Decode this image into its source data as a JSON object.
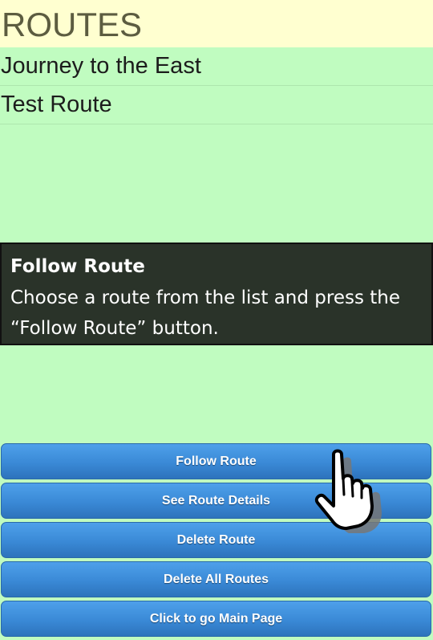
{
  "header": {
    "title": "ROUTES"
  },
  "routes": [
    {
      "name": "Journey to the East"
    },
    {
      "name": "Test Route"
    }
  ],
  "help": {
    "title": "Follow Route",
    "text": "Choose a route from the list and press the “Follow Route” button."
  },
  "buttons": {
    "follow": "Follow Route",
    "details": "See Route Details",
    "delete": "Delete Route",
    "delete_all": "Delete All Routes",
    "main_page": "Click to go Main Page"
  },
  "colors": {
    "background": "#c0fcc0",
    "header_bg": "#ffffd0",
    "button_blue": "#3a89d6",
    "help_bg": "#2a3329"
  },
  "icons": {
    "pointer": "hand-pointer-icon"
  }
}
